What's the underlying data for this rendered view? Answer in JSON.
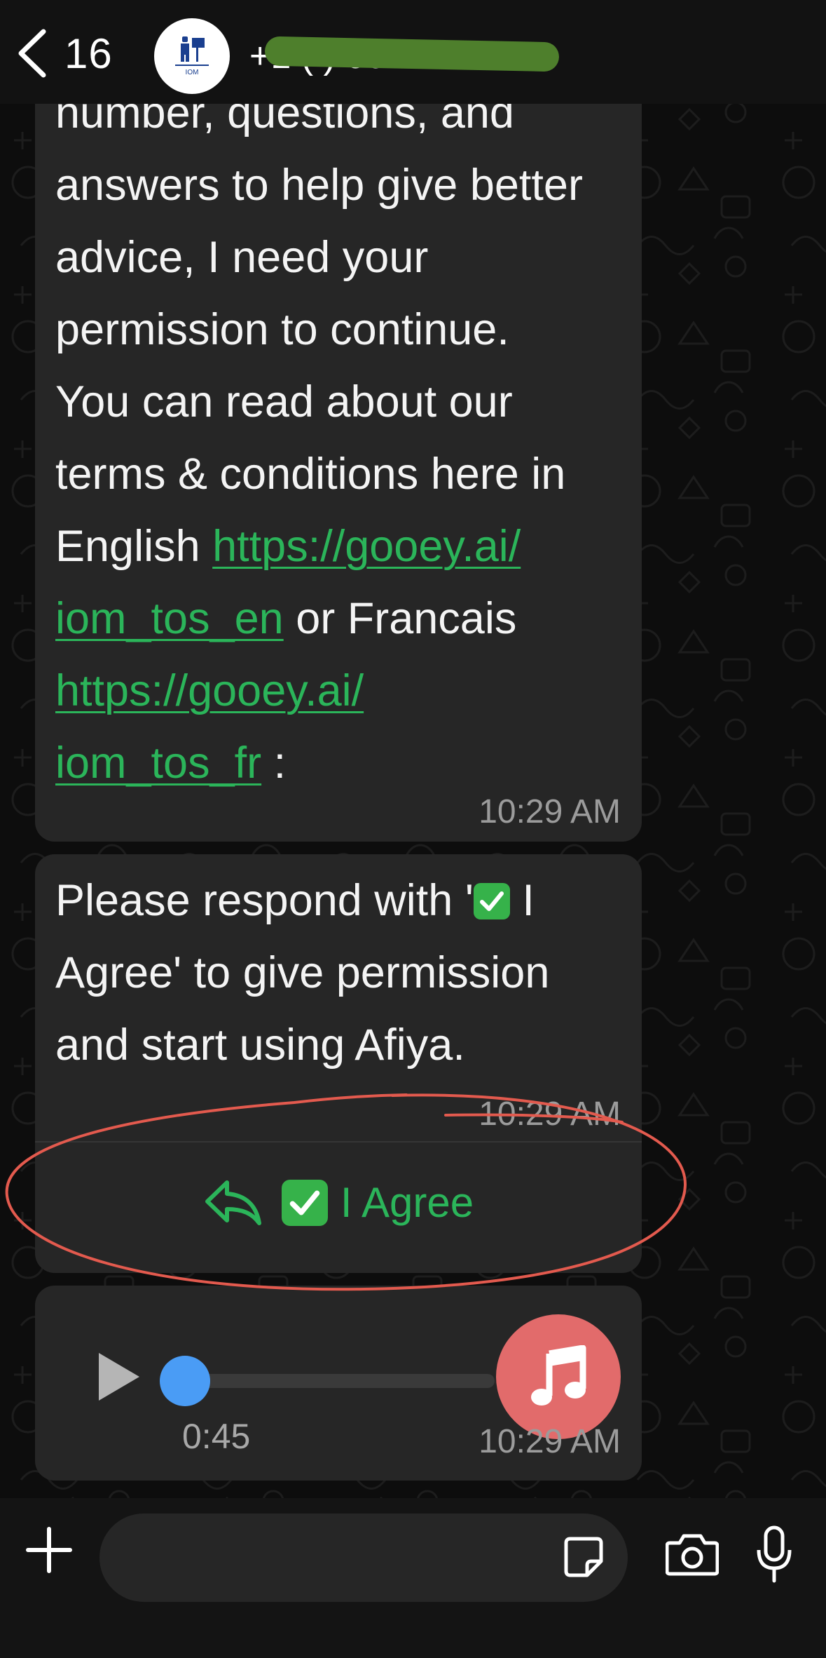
{
  "header": {
    "back_count": "16",
    "contact_name": "+1 (   ) 000-0005",
    "avatar_label": "IOM"
  },
  "messages": [
    {
      "lines": [
        {
          "parts": [
            {
              "text": "number, questions, and"
            }
          ]
        },
        {
          "parts": [
            {
              "text": "answers to help give better"
            }
          ]
        },
        {
          "parts": [
            {
              "text": "advice, I need your"
            }
          ]
        },
        {
          "parts": [
            {
              "text": "permission to continue."
            }
          ]
        },
        {
          "parts": [
            {
              "text": "You can read about our"
            }
          ]
        },
        {
          "parts": [
            {
              "text": "terms & conditions here in"
            }
          ]
        },
        {
          "parts": [
            {
              "text": "English "
            },
            {
              "text": "https://gooey.ai/",
              "link": true
            }
          ]
        },
        {
          "parts": [
            {
              "text": "iom_tos_en",
              "link": true
            },
            {
              "text": " or Francais"
            }
          ]
        },
        {
          "parts": [
            {
              "text": "https://gooey.ai/",
              "link": true
            }
          ]
        },
        {
          "parts": [
            {
              "text": "iom_tos_fr",
              "link": true
            },
            {
              "text": " :"
            }
          ]
        }
      ],
      "time": "10:29 AM"
    },
    {
      "line1_before": "Please respond with '",
      "line1_after": " I",
      "line2": "Agree' to give permission",
      "line3": "and start using Afiya.",
      "time": "10:29 AM",
      "button_label": "I Agree"
    },
    {
      "type": "audio",
      "duration": "0:45",
      "progress": 0.0,
      "time": "10:29 AM"
    }
  ],
  "composer": {
    "placeholder": "",
    "value": ""
  },
  "colors": {
    "link": "#2bb55a",
    "bubble": "#262626",
    "annotation": "#e35a4e",
    "accent_blue": "#4a9cf5",
    "audio_badge": "#e26b6b"
  },
  "icons": [
    "back-chevron-icon",
    "reply-arrow-icon",
    "check-mark-icon",
    "play-icon",
    "music-note-icon",
    "plus-icon",
    "sticker-icon",
    "camera-icon",
    "microphone-icon"
  ]
}
